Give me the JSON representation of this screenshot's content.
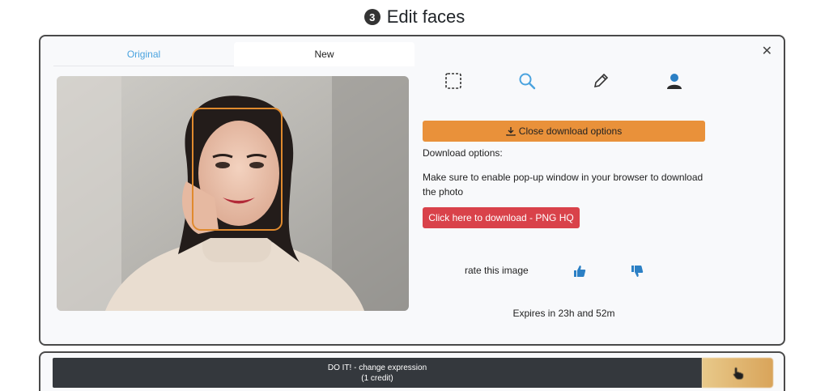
{
  "header": {
    "step_number": "3",
    "title": "Edit faces"
  },
  "tabs": [
    {
      "label": "Original",
      "active": false
    },
    {
      "label": "New",
      "active": true
    }
  ],
  "tools": [
    {
      "name": "select-region-icon"
    },
    {
      "name": "zoom-icon"
    },
    {
      "name": "pencil-icon"
    },
    {
      "name": "person-icon"
    }
  ],
  "download": {
    "close_label": "Close download options",
    "options_label": "Download options:",
    "note": "Make sure to enable pop-up window in your browser to download the photo",
    "png_label": "Click here to download - PNG HQ"
  },
  "rating": {
    "label": "rate this image"
  },
  "expires": "Expires in 23h and 52m",
  "action": {
    "line1": "DO IT! - change expression",
    "line2": "(1 credit)"
  },
  "colors": {
    "accent_orange": "#e9913a",
    "download_red": "#d9424a",
    "tab_blue": "#4aa3df",
    "dark_button": "#34383d"
  }
}
